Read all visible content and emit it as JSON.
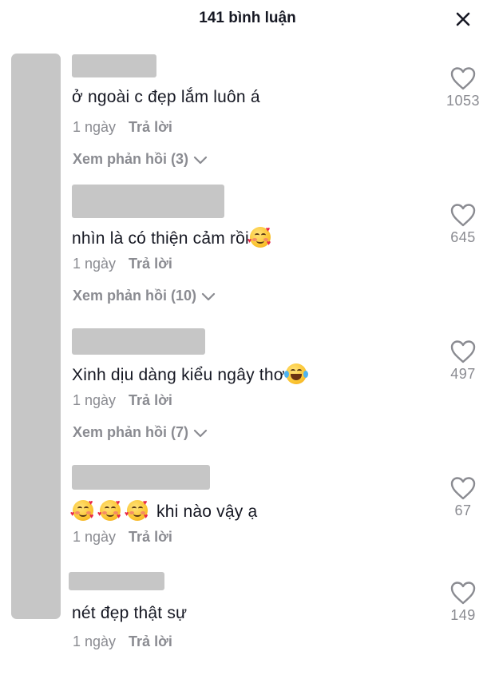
{
  "header": {
    "title": "141 bình luận",
    "close_icon": "close-icon"
  },
  "comments": [
    {
      "text": "ở ngoài c đẹp lắm luôn á",
      "time": "1 ngày",
      "reply": "Trả lời",
      "view_replies": "Xem phản hồi (3)",
      "likes": "1053"
    },
    {
      "text": "nhìn là có thiện cảm rồi",
      "emoji": "smiling-face-with-hearts",
      "time": "1 ngày",
      "reply": "Trả lời",
      "view_replies": "Xem phản hồi (10)",
      "likes": "645"
    },
    {
      "text": "Xinh dịu dàng kiểu ngây thơ",
      "emoji": "face-with-tears-of-joy",
      "time": "1 ngày",
      "reply": "Trả lời",
      "view_replies": "Xem phản hồi (7)",
      "likes": "497"
    },
    {
      "text": "khi nào vậy ạ",
      "emoji": "smiling-face-with-hearts x3",
      "time": "1 ngày",
      "reply": "Trả lời",
      "likes": "67"
    },
    {
      "text": "nét đẹp thật sự",
      "time": "1 ngày",
      "reply": "Trả lời",
      "likes": "149"
    }
  ],
  "colors": {
    "primary_text": "#161823",
    "secondary_text": "#8a8b91",
    "redaction": "#c6c6c6"
  }
}
